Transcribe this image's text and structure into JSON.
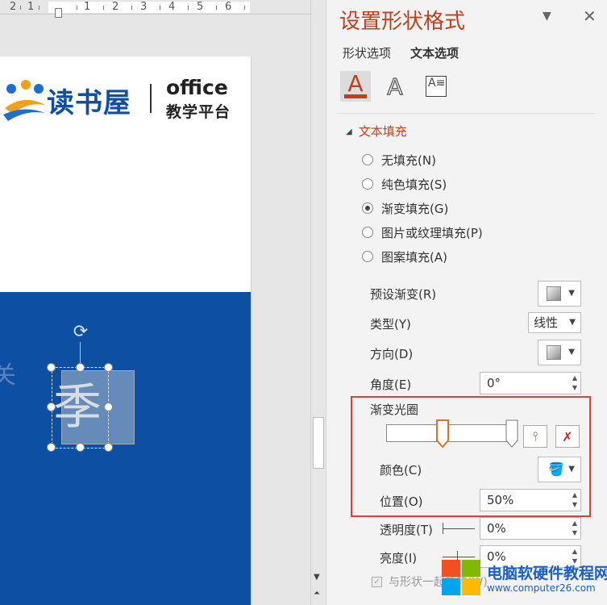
{
  "ruler": {
    "ticks": [
      "2",
      "1",
      "1",
      "2",
      "3",
      "4",
      "5",
      "6"
    ]
  },
  "slide": {
    "logo_text": "读书屋",
    "logo_office": "office",
    "logo_sub": "教学平台",
    "shape_text": "季",
    "ghost_text": "关"
  },
  "panel": {
    "title": "设置形状格式",
    "menu_icon": "▼",
    "close_icon": "✕",
    "tabs": [
      "形状选项",
      "文本选项"
    ],
    "section": "文本填充",
    "fill_options": [
      {
        "label": "无填充(N)",
        "selected": false
      },
      {
        "label": "纯色填充(S)",
        "selected": false
      },
      {
        "label": "渐变填充(G)",
        "selected": true
      },
      {
        "label": "图片或纹理填充(P)",
        "selected": false
      },
      {
        "label": "图案填充(A)",
        "selected": false
      }
    ],
    "preset_label": "预设渐变(R)",
    "type_label": "类型(Y)",
    "type_value": "线性",
    "direction_label": "方向(D)",
    "angle_label": "角度(E)",
    "angle_value": "0°",
    "stops_label": "渐变光圈",
    "color_label": "颜色(C)",
    "position_label": "位置(O)",
    "position_value": "50%",
    "transparency_label": "透明度(T)",
    "transparency_value": "0%",
    "brightness_label": "亮度(I)",
    "brightness_value": "0%",
    "checkbox_label": "与形状一起旋转(W)",
    "gradient_stops": [
      0.45,
      1.0
    ]
  },
  "watermark": {
    "title": "电脑软硬件教程网",
    "url": "www.computer26.com"
  },
  "colors": {
    "accent": "#c43e1c",
    "slide_blue": "#0d4fa3",
    "highlight": "#e23c3c"
  }
}
